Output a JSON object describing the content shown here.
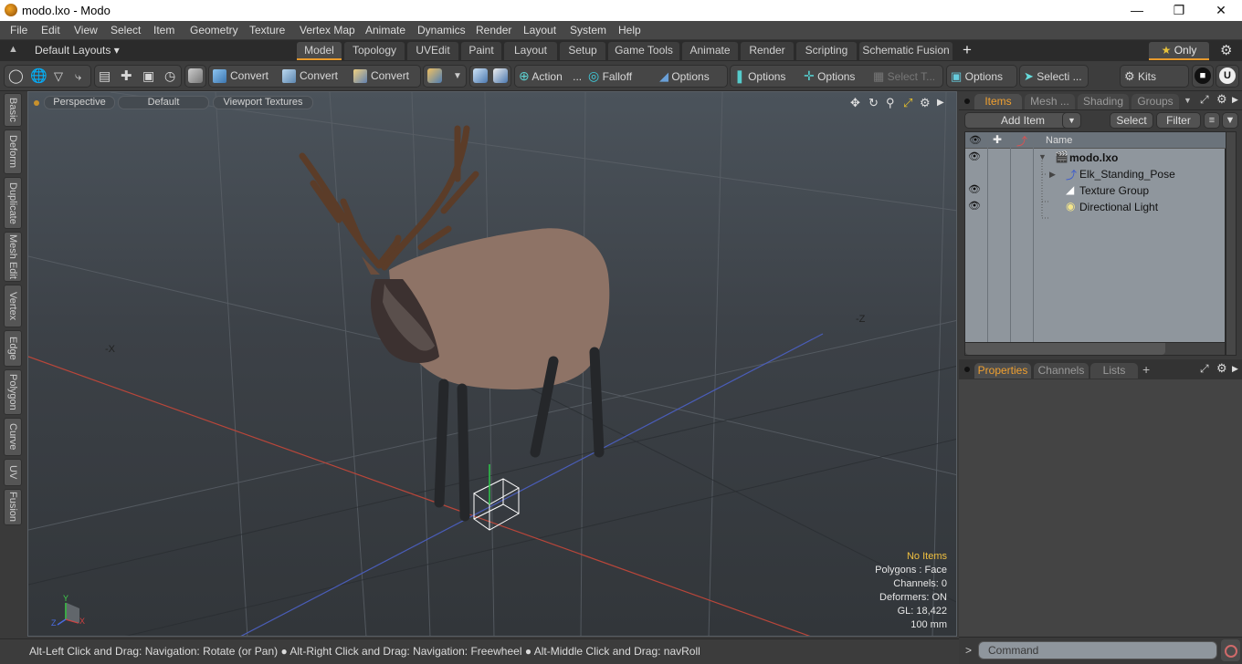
{
  "window": {
    "title": "modo.lxo - Modo",
    "minimize_label": "—",
    "maximize_label": "❐",
    "close_label": "✕"
  },
  "menu": [
    "File",
    "Edit",
    "View",
    "Select",
    "Item",
    "Geometry",
    "Texture",
    "Vertex Map",
    "Animate",
    "Dynamics",
    "Render",
    "Layout",
    "System",
    "Help"
  ],
  "layout_bar": {
    "layouts_label": "Default Layouts ▾",
    "tabs": [
      "Model",
      "Topology",
      "UVEdit",
      "Paint",
      "Layout",
      "Setup",
      "Game Tools",
      "Animate",
      "Render",
      "Scripting",
      "Schematic Fusion"
    ],
    "active_tab": "Model",
    "add_tab": "+",
    "only_label": "★ Only",
    "settings": "⚙"
  },
  "toolbar": {
    "convert1": "Convert",
    "convert2": "Convert",
    "convert3": "Convert",
    "action": "Action",
    "action_more": "...",
    "falloff": "Falloff",
    "options1": "Options",
    "options2": "Options",
    "options3": "Options",
    "select_t": "Select T...",
    "options4": "Options",
    "selecti": "Selecti ...",
    "kits": "Kits"
  },
  "left_tabs": [
    "Basic",
    "Deform",
    "Duplicate",
    "Mesh Edit",
    "Vertex",
    "Edge",
    "Polygon",
    "Curve",
    "UV",
    "Fusion"
  ],
  "viewport": {
    "view_mode": "Perspective",
    "shading": "Default",
    "textures": "Viewport Textures",
    "axis_neg_x": "-X",
    "axis_neg_z": "-Z",
    "hud": {
      "selection": "No Items",
      "polygons": "Polygons : Face",
      "channels": "Channels: 0",
      "deformers": "Deformers: ON",
      "gl": "GL: 18,422",
      "unit": "100 mm"
    },
    "gizmo": {
      "y": "Y",
      "x": "X",
      "z": "Z"
    }
  },
  "status_bar": {
    "hint": "Alt-Left Click and Drag: Navigation: Rotate (or Pan) ● Alt-Right Click and Drag: Navigation: Freewheel ● Alt-Middle Click and Drag: navRoll"
  },
  "items_panel": {
    "tabs": [
      "Items",
      "Mesh ...",
      "Shading",
      "Groups"
    ],
    "active_tab": "Items",
    "add_item": "Add Item",
    "select": "Select",
    "filter": "Filter",
    "column_name": "Name",
    "rows": [
      {
        "name": "modo.lxo",
        "visible": true,
        "bold": true,
        "icon": "scene-icon"
      },
      {
        "name": "Elk_Standing_Pose",
        "visible": false,
        "bold": false,
        "icon": "locator-icon"
      },
      {
        "name": "Texture Group",
        "visible": true,
        "bold": false,
        "icon": "texture-group-icon"
      },
      {
        "name": "Directional Light",
        "visible": true,
        "bold": false,
        "icon": "light-icon"
      }
    ]
  },
  "properties_panel": {
    "tabs": [
      "Properties",
      "Channels",
      "Lists"
    ],
    "active_tab": "Properties",
    "add_tab": "+"
  },
  "command": {
    "prompt": ">",
    "placeholder": "Command"
  }
}
